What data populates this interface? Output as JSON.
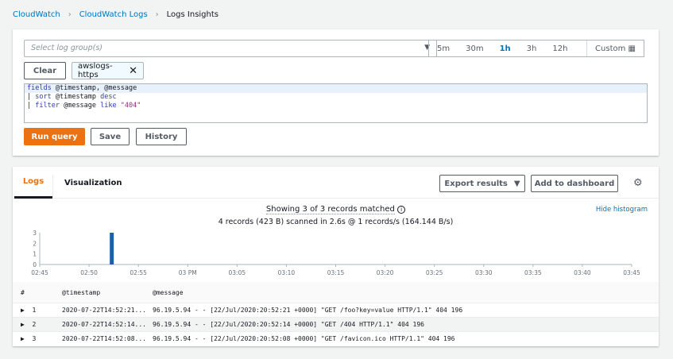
{
  "breadcrumb": [
    "CloudWatch",
    "CloudWatch Logs",
    "Logs Insights"
  ],
  "query": {
    "log_group_placeholder": "Select log group(s)",
    "time_ranges": [
      "5m",
      "30m",
      "1h",
      "3h",
      "12h"
    ],
    "selected_range": "1h",
    "custom_label": "Custom",
    "clear_label": "Clear",
    "selected_group": "awslogs-https",
    "lines": [
      [
        {
          "t": "fields",
          "k": "kw"
        },
        {
          "t": " @timestamp, @message",
          "k": ""
        }
      ],
      [
        {
          "t": "| ",
          "k": ""
        },
        {
          "t": "sort",
          "k": "kw"
        },
        {
          "t": " @timestamp ",
          "k": ""
        },
        {
          "t": "desc",
          "k": "kw"
        }
      ],
      [
        {
          "t": "| ",
          "k": ""
        },
        {
          "t": "filter",
          "k": "kw"
        },
        {
          "t": " @message ",
          "k": ""
        },
        {
          "t": "like",
          "k": "kw"
        },
        {
          "t": " \"404\"",
          "k": "str"
        }
      ]
    ],
    "run_label": "Run query",
    "save_label": "Save",
    "history_label": "History"
  },
  "results": {
    "tabs": [
      "Logs",
      "Visualization"
    ],
    "export_label": "Export results",
    "dashboard_label": "Add to dashboard",
    "showing": "Showing 3 of 3 records matched",
    "scanned": "4 records (423 B) scanned in 2.6s @ 1 records/s (164.144 B/s)",
    "hide_histogram": "Hide histogram",
    "columns": [
      "#",
      "@timestamp",
      "@message"
    ],
    "rows": [
      {
        "n": "1",
        "ts": "2020-07-22T14:52:21...",
        "msg": "96.19.5.94 - - [22/Jul/2020:20:52:21 +0000] \"GET /foo?key=value HTTP/1.1\" 404 196"
      },
      {
        "n": "2",
        "ts": "2020-07-22T14:52:14...",
        "msg": "96.19.5.94 - - [22/Jul/2020:20:52:14 +0000] \"GET /404 HTTP/1.1\" 404 196"
      },
      {
        "n": "3",
        "ts": "2020-07-22T14:52:08...",
        "msg": "96.19.5.94 - - [22/Jul/2020:20:52:08 +0000] \"GET /favicon.ico HTTP/1.1\" 404 196"
      }
    ]
  },
  "chart_data": {
    "type": "bar",
    "x_ticks": [
      "02:45",
      "02:50",
      "02:55",
      "03 PM",
      "03:05",
      "03:10",
      "03:15",
      "03:20",
      "03:25",
      "03:30",
      "03:35",
      "03:40",
      "03:45"
    ],
    "y_ticks": [
      "0",
      "1",
      "2",
      "3"
    ],
    "ylim": [
      0,
      3
    ],
    "xlim_minutes": [
      0,
      60
    ],
    "bars": [
      {
        "minute": 7.3,
        "value": 3
      }
    ],
    "bar_color": "#1f5fa8"
  }
}
